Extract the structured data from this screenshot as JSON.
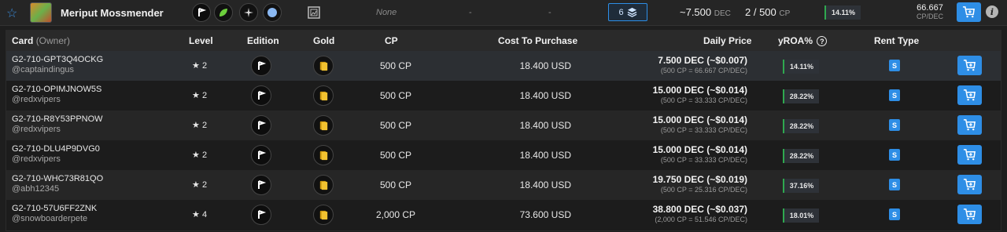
{
  "header": {
    "card_name": "Meriput Mossmender",
    "none_text": "None",
    "dash1": "-",
    "dash2": "-",
    "count": "6",
    "price_value": "~7.500",
    "price_unit": "DEC",
    "cp_value": "2 / 500",
    "cp_unit": "CP",
    "roa": "14.11%",
    "ratio_value": "66.667",
    "ratio_unit": "CP/DEC",
    "icons": [
      "star-outline-icon",
      "card-thumbnail",
      "edition-icon",
      "leaf-icon",
      "compass-icon",
      "element-circle-icon",
      "frame-icon",
      "layers-icon",
      "cart-icon",
      "info-icon"
    ]
  },
  "columns": {
    "card": "Card",
    "owner": "(Owner)",
    "level": "Level",
    "edition": "Edition",
    "gold": "Gold",
    "cp": "CP",
    "cost": "Cost To Purchase",
    "daily": "Daily Price",
    "yroa": "yROA%",
    "rent_type": "Rent Type"
  },
  "rows": [
    {
      "id": "G2-710-GPT3Q4OCKG",
      "owner": "@captaindingus",
      "level": "2",
      "cp": "500 CP",
      "cost": "18.400 USD",
      "daily": "7.500 DEC (~$0.007)",
      "daily_sub": "(500 CP = 66.667 CP/DEC)",
      "roa": "14.11%",
      "rent": "S"
    },
    {
      "id": "G2-710-OPIMJNOW5S",
      "owner": "@redxvipers",
      "level": "2",
      "cp": "500 CP",
      "cost": "18.400 USD",
      "daily": "15.000 DEC (~$0.014)",
      "daily_sub": "(500 CP = 33.333 CP/DEC)",
      "roa": "28.22%",
      "rent": "S"
    },
    {
      "id": "G2-710-R8Y53PPNOW",
      "owner": "@redxvipers",
      "level": "2",
      "cp": "500 CP",
      "cost": "18.400 USD",
      "daily": "15.000 DEC (~$0.014)",
      "daily_sub": "(500 CP = 33.333 CP/DEC)",
      "roa": "28.22%",
      "rent": "S"
    },
    {
      "id": "G2-710-DLU4P9DVG0",
      "owner": "@redxvipers",
      "level": "2",
      "cp": "500 CP",
      "cost": "18.400 USD",
      "daily": "15.000 DEC (~$0.014)",
      "daily_sub": "(500 CP = 33.333 CP/DEC)",
      "roa": "28.22%",
      "rent": "S"
    },
    {
      "id": "G2-710-WHC73R81QO",
      "owner": "@abh12345",
      "level": "2",
      "cp": "500 CP",
      "cost": "18.400 USD",
      "daily": "19.750 DEC (~$0.019)",
      "daily_sub": "(500 CP = 25.316 CP/DEC)",
      "roa": "37.16%",
      "rent": "S"
    },
    {
      "id": "G2-710-57U6FF2ZNK",
      "owner": "@snowboarderpete",
      "level": "4",
      "cp": "2,000 CP",
      "cost": "73.600 USD",
      "daily": "38.800 DEC (~$0.037)",
      "daily_sub": "(2,000 CP = 51.546 CP/DEC)",
      "roa": "18.01%",
      "rent": "S"
    }
  ],
  "colors": {
    "accent": "#2e8ee6",
    "roa_green": "#2fa84f",
    "background": "#1e1e1e"
  }
}
